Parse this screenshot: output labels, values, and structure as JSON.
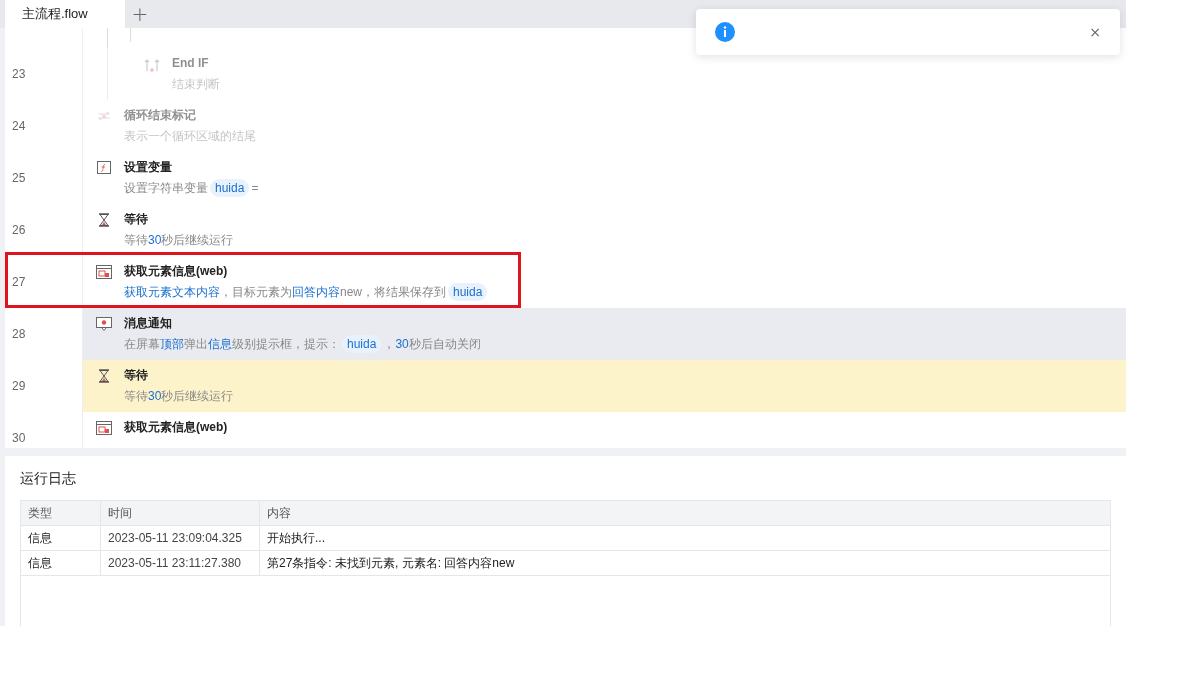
{
  "tabs": [
    {
      "label": "主流程.flow",
      "selected": true
    }
  ],
  "add_tab": "+",
  "rows": [
    {
      "children": [
        {
          "number": "23",
          "kind": "end_if",
          "title": "End IF",
          "dimmed": true,
          "selected": false,
          "highlighted": false,
          "boxed": false,
          "description": [
            {
              "kind": "plain",
              "text": "结束判断"
            }
          ]
        }
      ]
    },
    {
      "number": "24",
      "kind": "loop_end",
      "title": "循环结束标记",
      "dimmed": true,
      "selected": false,
      "highlighted": false,
      "boxed": false,
      "description": [
        {
          "kind": "plain",
          "text": "表示一个循环区域的结尾"
        }
      ]
    },
    {
      "number": "25",
      "kind": "set_var",
      "title": "设置变量",
      "dimmed": false,
      "selected": false,
      "highlighted": false,
      "boxed": false,
      "description": [
        {
          "kind": "plain",
          "text": "设置字符串变量"
        },
        {
          "kind": "var",
          "text": "huida"
        },
        {
          "kind": "plain",
          "text": "="
        }
      ]
    },
    {
      "number": "26",
      "kind": "wait",
      "title": "等待",
      "dimmed": false,
      "selected": false,
      "highlighted": false,
      "boxed": false,
      "description": [
        {
          "kind": "plain",
          "text": "等待"
        },
        {
          "kind": "link",
          "text": "30"
        },
        {
          "kind": "plain",
          "text": "秒后继续运行"
        }
      ]
    },
    {
      "number": "27",
      "kind": "get_element",
      "title": "获取元素信息(web)",
      "dimmed": false,
      "selected": false,
      "highlighted": false,
      "boxed": true,
      "description": [
        {
          "kind": "link",
          "text": "获取元素文本内容"
        },
        {
          "kind": "plain",
          "text": "，目标元素为"
        },
        {
          "kind": "link",
          "text": "回答内容"
        },
        {
          "kind": "plain",
          "text": "new，将结果保存到"
        },
        {
          "kind": "var",
          "text": "huida"
        }
      ]
    },
    {
      "number": "28",
      "kind": "notify",
      "title": "消息通知",
      "dimmed": false,
      "selected": true,
      "highlighted": false,
      "boxed": false,
      "description": [
        {
          "kind": "plain",
          "text": "在屏幕"
        },
        {
          "kind": "link",
          "text": "顶部"
        },
        {
          "kind": "plain",
          "text": "弹出"
        },
        {
          "kind": "link",
          "text": "信息"
        },
        {
          "kind": "plain",
          "text": "级别提示框，提示："
        },
        {
          "kind": "var",
          "text": "huida"
        },
        {
          "kind": "plain",
          "text": "，"
        },
        {
          "kind": "link",
          "text": "30"
        },
        {
          "kind": "plain",
          "text": "秒后自动关闭"
        }
      ]
    },
    {
      "number": "29",
      "kind": "wait",
      "title": "等待",
      "dimmed": false,
      "selected": false,
      "highlighted": true,
      "boxed": false,
      "description": [
        {
          "kind": "plain",
          "text": "等待"
        },
        {
          "kind": "link",
          "text": "30"
        },
        {
          "kind": "plain",
          "text": "秒后继续运行"
        }
      ]
    },
    {
      "number": "30",
      "kind": "get_element",
      "title": "获取元素信息(web)",
      "dimmed": false,
      "selected": false,
      "highlighted": false,
      "boxed": false
    }
  ],
  "log": {
    "title": "运行日志",
    "columns": [
      "类型",
      "时间",
      "内容"
    ],
    "rows": [
      [
        "信息",
        "2023-05-11 23:09:04.325",
        "开始执行..."
      ],
      [
        "信息",
        "2023-05-11 23:11:27.380",
        "第27条指令: 未找到元素, 元素名: 回答内容new"
      ]
    ]
  },
  "toast": {
    "close": "×"
  }
}
